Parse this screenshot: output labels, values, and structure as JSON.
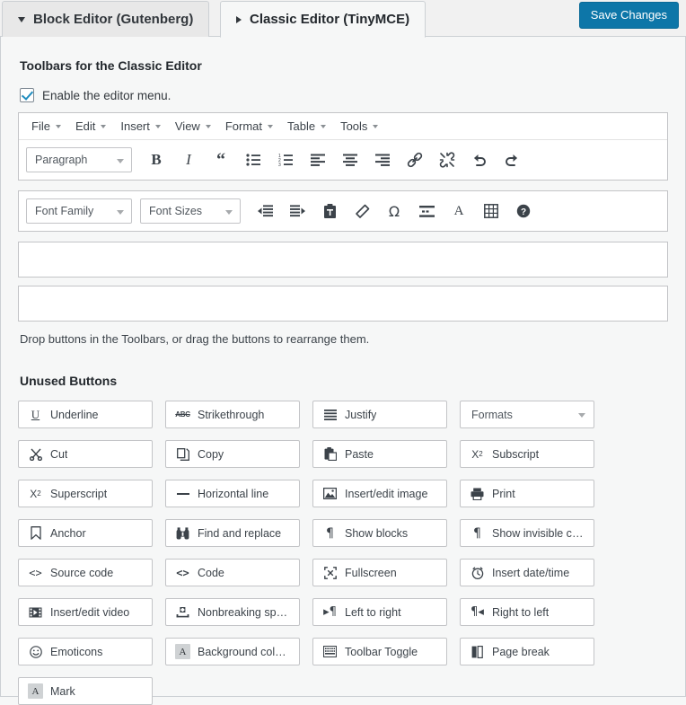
{
  "tabs": [
    {
      "label": "Block Editor (Gutenberg)",
      "state": "inactive",
      "marker": "triangle-down"
    },
    {
      "label": "Classic Editor (TinyMCE)",
      "state": "active",
      "marker": "triangle-right"
    }
  ],
  "save_button": {
    "label": "Save Changes",
    "color": "#0d76a8"
  },
  "section": {
    "toolbars_title": "Toolbars for the Classic Editor",
    "enable_menu_label": "Enable the editor menu.",
    "enable_menu_checked": true,
    "hint": "Drop buttons in the Toolbars, or drag the buttons to rearrange them.",
    "unused_title": "Unused Buttons"
  },
  "menubar": [
    {
      "label": "File"
    },
    {
      "label": "Edit"
    },
    {
      "label": "Insert"
    },
    {
      "label": "View"
    },
    {
      "label": "Format"
    },
    {
      "label": "Table"
    },
    {
      "label": "Tools"
    }
  ],
  "toolbar_row1": {
    "format_select": "Paragraph",
    "buttons": [
      {
        "name": "bold",
        "icon": "bold-icon"
      },
      {
        "name": "italic",
        "icon": "italic-icon"
      },
      {
        "name": "blockquote",
        "icon": "blockquote-icon"
      },
      {
        "name": "bullet-list",
        "icon": "bullet-list-icon"
      },
      {
        "name": "numbered-list",
        "icon": "numbered-list-icon"
      },
      {
        "name": "align-left",
        "icon": "align-left-icon"
      },
      {
        "name": "align-center",
        "icon": "align-center-icon"
      },
      {
        "name": "align-right",
        "icon": "align-right-icon"
      },
      {
        "name": "link",
        "icon": "link-icon"
      },
      {
        "name": "unlink",
        "icon": "unlink-icon"
      },
      {
        "name": "undo",
        "icon": "undo-icon"
      },
      {
        "name": "redo",
        "icon": "redo-icon"
      }
    ]
  },
  "toolbar_row2": {
    "font_family_select": "Font Family",
    "font_sizes_select": "Font Sizes",
    "buttons": [
      {
        "name": "outdent",
        "icon": "outdent-icon"
      },
      {
        "name": "indent",
        "icon": "indent-icon"
      },
      {
        "name": "paste-as-text",
        "icon": "paste-text-icon"
      },
      {
        "name": "clear-formatting",
        "icon": "eraser-icon"
      },
      {
        "name": "special-character",
        "icon": "omega-icon"
      },
      {
        "name": "read-more",
        "icon": "read-more-icon"
      },
      {
        "name": "text-color",
        "icon": "text-color-icon"
      },
      {
        "name": "table",
        "icon": "table-icon"
      },
      {
        "name": "keyboard-shortcuts",
        "icon": "help-icon"
      }
    ]
  },
  "unused_buttons": [
    {
      "label": "Underline",
      "icon": "underline-icon"
    },
    {
      "label": "Strikethrough",
      "icon": "strikethrough-icon"
    },
    {
      "label": "Justify",
      "icon": "justify-icon"
    },
    {
      "label": "Formats",
      "icon": "none",
      "type": "select"
    },
    {
      "label": "Cut",
      "icon": "scissors-icon"
    },
    {
      "label": "Copy",
      "icon": "copy-icon"
    },
    {
      "label": "Paste",
      "icon": "clipboard-icon"
    },
    {
      "label": "Subscript",
      "icon": "subscript-icon"
    },
    {
      "label": "Superscript",
      "icon": "superscript-icon"
    },
    {
      "label": "Horizontal line",
      "icon": "horizontal-rule-icon"
    },
    {
      "label": "Insert/edit image",
      "icon": "image-icon"
    },
    {
      "label": "Print",
      "icon": "printer-icon"
    },
    {
      "label": "Anchor",
      "icon": "anchor-bookmark-icon"
    },
    {
      "label": "Find and replace",
      "icon": "binoculars-icon"
    },
    {
      "label": "Show blocks",
      "icon": "pilcrow-icon"
    },
    {
      "label": "Show invisible chara...",
      "icon": "pilcrow-icon"
    },
    {
      "label": "Source code",
      "icon": "angle-brackets-icon"
    },
    {
      "label": "Code",
      "icon": "angle-brackets-bold-icon"
    },
    {
      "label": "Fullscreen",
      "icon": "fullscreen-icon"
    },
    {
      "label": "Insert date/time",
      "icon": "clock-icon"
    },
    {
      "label": "Insert/edit video",
      "icon": "film-icon"
    },
    {
      "label": "Nonbreaking space",
      "icon": "nonbreaking-space-icon"
    },
    {
      "label": "Left to right",
      "icon": "ltr-icon"
    },
    {
      "label": "Right to left",
      "icon": "rtl-icon"
    },
    {
      "label": "Emoticons",
      "icon": "smiley-icon"
    },
    {
      "label": "Background colour",
      "icon": "background-color-icon"
    },
    {
      "label": "Toolbar Toggle",
      "icon": "toolbar-toggle-icon"
    },
    {
      "label": "Page break",
      "icon": "page-break-icon"
    },
    {
      "label": "Mark",
      "icon": "mark-icon"
    }
  ]
}
